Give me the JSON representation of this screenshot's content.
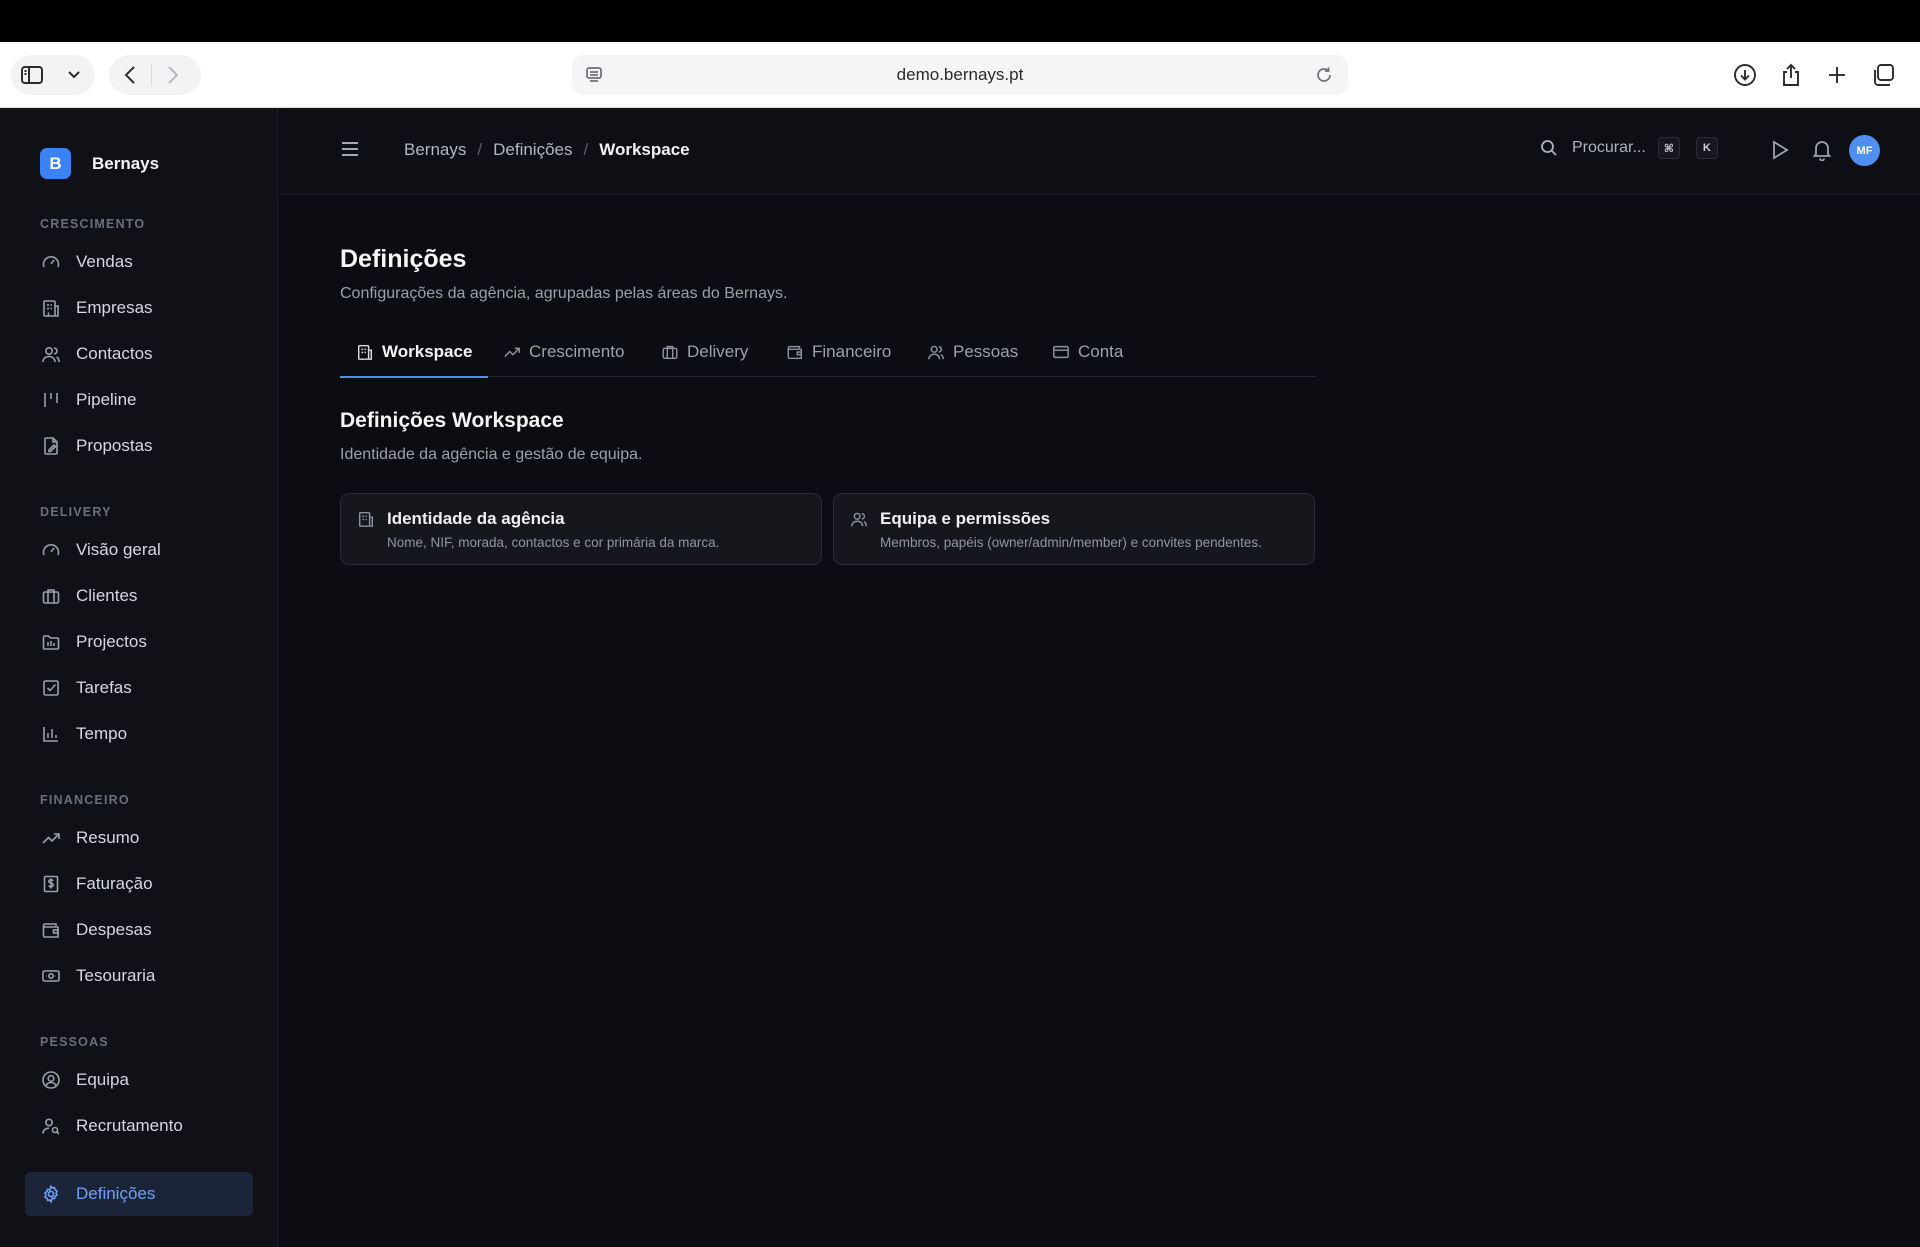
{
  "browser": {
    "url": "demo.bernays.pt"
  },
  "sidebar": {
    "brand": {
      "logo_letter": "B",
      "name": "Bernays"
    },
    "sections": [
      {
        "label": "CRESCIMENTO",
        "items": [
          {
            "label": "Vendas",
            "icon": "gauge-icon"
          },
          {
            "label": "Empresas",
            "icon": "building-icon"
          },
          {
            "label": "Contactos",
            "icon": "users-icon"
          },
          {
            "label": "Pipeline",
            "icon": "kanban-icon"
          },
          {
            "label": "Propostas",
            "icon": "file-edit-icon"
          }
        ]
      },
      {
        "label": "DELIVERY",
        "items": [
          {
            "label": "Visão geral",
            "icon": "gauge-icon"
          },
          {
            "label": "Clientes",
            "icon": "briefcase-icon"
          },
          {
            "label": "Projectos",
            "icon": "folder-icon"
          },
          {
            "label": "Tarefas",
            "icon": "checkbox-icon"
          },
          {
            "label": "Tempo",
            "icon": "bar-chart-icon"
          }
        ]
      },
      {
        "label": "FINANCEIRO",
        "items": [
          {
            "label": "Resumo",
            "icon": "trending-up-icon"
          },
          {
            "label": "Faturação",
            "icon": "invoice-icon"
          },
          {
            "label": "Despesas",
            "icon": "wallet-icon"
          },
          {
            "label": "Tesouraria",
            "icon": "banknote-icon"
          }
        ]
      },
      {
        "label": "PESSOAS",
        "items": [
          {
            "label": "Equipa",
            "icon": "user-circle-icon"
          },
          {
            "label": "Recrutamento",
            "icon": "user-search-icon"
          }
        ]
      }
    ],
    "settings": {
      "label": "Definições",
      "icon": "gear-icon",
      "active": true
    }
  },
  "topnav": {
    "breadcrumb": [
      "Bernays",
      "Definições",
      "Workspace"
    ],
    "search_placeholder": "Procurar...",
    "shortcut_keys": [
      "⌘",
      "K"
    ],
    "avatar_initials": "MF"
  },
  "page": {
    "title": "Definições",
    "subtitle": "Configurações da agência, agrupadas pelas áreas do Bernays.",
    "tabs": [
      {
        "label": "Workspace",
        "icon": "building-icon",
        "active": true
      },
      {
        "label": "Crescimento",
        "icon": "trending-up-icon"
      },
      {
        "label": "Delivery",
        "icon": "briefcase-icon"
      },
      {
        "label": "Financeiro",
        "icon": "wallet-icon"
      },
      {
        "label": "Pessoas",
        "icon": "users-icon"
      },
      {
        "label": "Conta",
        "icon": "credit-card-icon"
      }
    ],
    "section_title": "Definições Workspace",
    "section_subtitle": "Identidade da agência e gestão de equipa.",
    "cards": [
      {
        "title": "Identidade da agência",
        "description": "Nome, NIF, morada, contactos e cor primária da marca.",
        "icon": "building-icon"
      },
      {
        "title": "Equipa e permissões",
        "description": "Membros, papéis (owner/admin/member) e convites pendentes.",
        "icon": "users-icon"
      }
    ]
  },
  "colors": {
    "accent": "#4f8ff0",
    "sidebar_bg": "#101117",
    "content_bg": "#0c0d12"
  }
}
